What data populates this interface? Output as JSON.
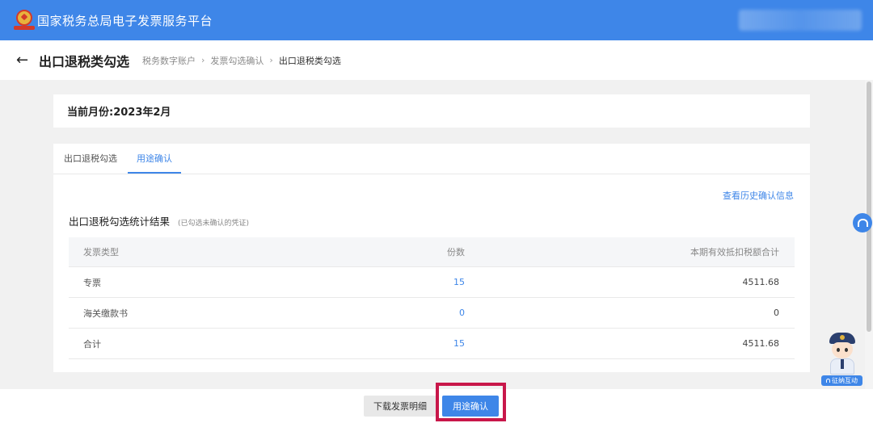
{
  "app": {
    "title": "国家税务总局电子发票服务平台"
  },
  "header": {
    "page_title": "出口退税类勾选",
    "breadcrumb": [
      "税务数字账户",
      "发票勾选确认",
      "出口退税类勾选"
    ],
    "back_icon": "arrow-left-icon"
  },
  "month": {
    "label": "当前月份:2023年2月"
  },
  "tabs": [
    {
      "label": "出口退税勾选",
      "active": false
    },
    {
      "label": "用途确认",
      "active": true
    }
  ],
  "history_link": "查看历史确认信息",
  "stats": {
    "title": "出口退税勾选统计结果",
    "note": "(已勾选未确认的凭证)"
  },
  "table": {
    "columns": [
      "发票类型",
      "份数",
      "本期有效抵扣税额合计"
    ],
    "rows": [
      {
        "type": "专票",
        "count": "15",
        "amount": "4511.68"
      },
      {
        "type": "海关缴款书",
        "count": "0",
        "amount": "0"
      },
      {
        "type": "合计",
        "count": "15",
        "amount": "4511.68"
      }
    ]
  },
  "footer": {
    "download_label": "下载发票明细",
    "confirm_label": "用途确认"
  },
  "assistant": {
    "label": "征纳互动",
    "icon": "headset-icon"
  },
  "colors": {
    "brand": "#3e86e8",
    "highlight": "#c8174a"
  }
}
